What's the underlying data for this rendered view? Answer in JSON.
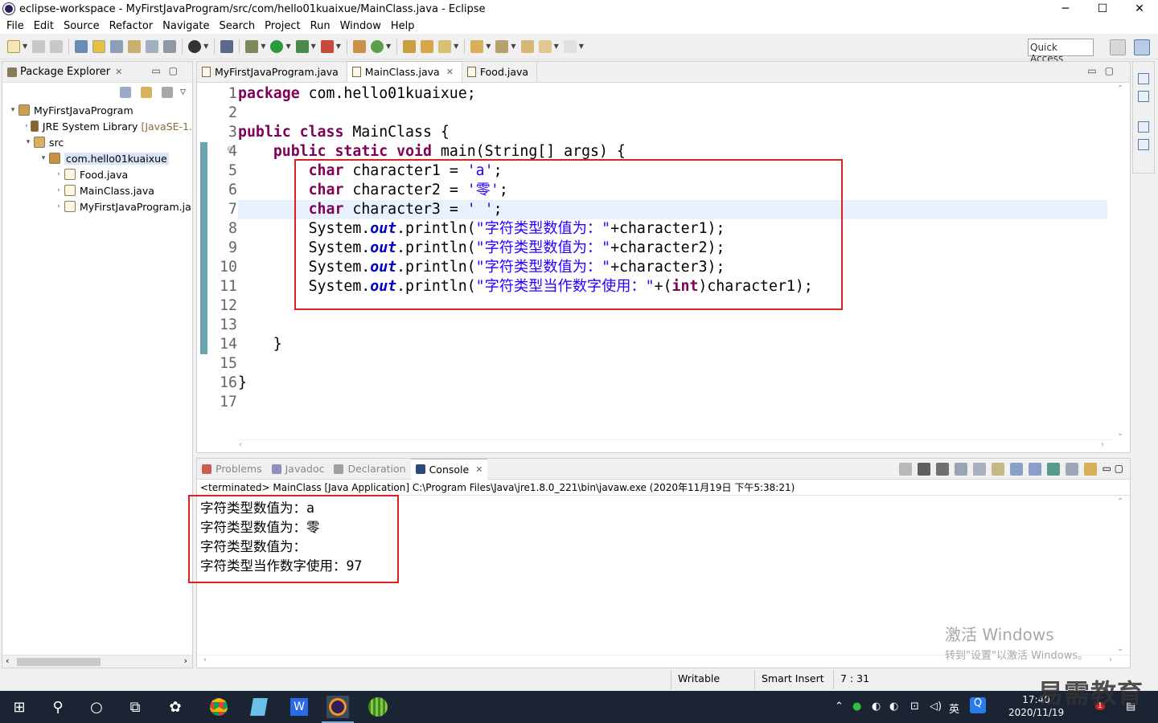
{
  "window": {
    "title": "eclipse-workspace - MyFirstJavaProgram/src/com/hello01kuaixue/MainClass.java - Eclipse",
    "controls": [
      "─",
      "☐",
      "✕"
    ]
  },
  "menu": [
    "File",
    "Edit",
    "Source",
    "Refactor",
    "Navigate",
    "Search",
    "Project",
    "Run",
    "Window",
    "Help"
  ],
  "toolbar": {
    "quick_access": "Quick Access"
  },
  "package_explorer": {
    "title": "Package Explorer",
    "close": "✕",
    "tree": [
      {
        "indent": 0,
        "arrow": "▾",
        "name": "MyFirstJavaProgram",
        "extra": "",
        "icon_color": "#c8a050"
      },
      {
        "indent": 1,
        "arrow": "›",
        "name": "JRE System Library",
        "extra": "[JavaSE-1.",
        "icon_color": "#8a6030"
      },
      {
        "indent": 1,
        "arrow": "▾",
        "name": "src",
        "extra": "",
        "icon_color": "#d8b060"
      },
      {
        "indent": 2,
        "arrow": "▾",
        "name": "com.hello01kuaixue",
        "extra": "",
        "icon_color": "#c89040",
        "selected": true
      },
      {
        "indent": 3,
        "arrow": "›",
        "name": "Food.java",
        "extra": "",
        "icon_color": "#fdf6e0"
      },
      {
        "indent": 3,
        "arrow": "›",
        "name": "MainClass.java",
        "extra": "",
        "icon_color": "#fdf6e0"
      },
      {
        "indent": 3,
        "arrow": "›",
        "name": "MyFirstJavaProgram.ja",
        "extra": "",
        "icon_color": "#fdf6e0"
      }
    ]
  },
  "editor": {
    "tabs": [
      {
        "label": "MyFirstJavaProgram.java",
        "active": false,
        "close": ""
      },
      {
        "label": "MainClass.java",
        "active": true,
        "close": "✕"
      },
      {
        "label": "Food.java",
        "active": false,
        "close": ""
      }
    ],
    "line_numbers": [
      "1",
      "2",
      "3",
      "4",
      "5",
      "6",
      "7",
      "8",
      "9",
      "10",
      "11",
      "12",
      "13",
      "14",
      "15",
      "16",
      "17"
    ],
    "current_line": 7,
    "lines": [
      [
        {
          "t": "kw",
          "v": "package"
        },
        {
          "t": "",
          "v": " com.hello01kuaixue;"
        }
      ],
      [],
      [
        {
          "t": "kw",
          "v": "public"
        },
        {
          "t": "",
          "v": " "
        },
        {
          "t": "kw",
          "v": "class"
        },
        {
          "t": "",
          "v": " MainClass {"
        }
      ],
      [
        {
          "t": "",
          "v": "    "
        },
        {
          "t": "kw",
          "v": "public"
        },
        {
          "t": "",
          "v": " "
        },
        {
          "t": "kw",
          "v": "static"
        },
        {
          "t": "",
          "v": " "
        },
        {
          "t": "kw",
          "v": "void"
        },
        {
          "t": "",
          "v": " main(String[] args) {"
        }
      ],
      [
        {
          "t": "",
          "v": "        "
        },
        {
          "t": "kw",
          "v": "char"
        },
        {
          "t": "",
          "v": " character1 = "
        },
        {
          "t": "str",
          "v": "'a'"
        },
        {
          "t": "",
          "v": ";"
        }
      ],
      [
        {
          "t": "",
          "v": "        "
        },
        {
          "t": "kw",
          "v": "char"
        },
        {
          "t": "",
          "v": " character2 = "
        },
        {
          "t": "str",
          "v": "'零'"
        },
        {
          "t": "",
          "v": ";"
        }
      ],
      [
        {
          "t": "",
          "v": "        "
        },
        {
          "t": "kw",
          "v": "char"
        },
        {
          "t": "",
          "v": " character3 = "
        },
        {
          "t": "str",
          "v": "' '"
        },
        {
          "t": "",
          "v": ";"
        }
      ],
      [
        {
          "t": "",
          "v": "        System."
        },
        {
          "t": "fld",
          "v": "out"
        },
        {
          "t": "",
          "v": ".println("
        },
        {
          "t": "str",
          "v": "\"字符类型数值为：\""
        },
        {
          "t": "",
          "v": "+character1);"
        }
      ],
      [
        {
          "t": "",
          "v": "        System."
        },
        {
          "t": "fld",
          "v": "out"
        },
        {
          "t": "",
          "v": ".println("
        },
        {
          "t": "str",
          "v": "\"字符类型数值为：\""
        },
        {
          "t": "",
          "v": "+character2);"
        }
      ],
      [
        {
          "t": "",
          "v": "        System."
        },
        {
          "t": "fld",
          "v": "out"
        },
        {
          "t": "",
          "v": ".println("
        },
        {
          "t": "str",
          "v": "\"字符类型数值为：\""
        },
        {
          "t": "",
          "v": "+character3);"
        }
      ],
      [
        {
          "t": "",
          "v": "        System."
        },
        {
          "t": "fld",
          "v": "out"
        },
        {
          "t": "",
          "v": ".println("
        },
        {
          "t": "str",
          "v": "\"字符类型当作数字使用：\""
        },
        {
          "t": "",
          "v": "+("
        },
        {
          "t": "kw",
          "v": "int"
        },
        {
          "t": "",
          "v": ")character1);"
        }
      ],
      [],
      [],
      [
        {
          "t": "",
          "v": "    }"
        }
      ],
      [],
      [
        {
          "t": "",
          "v": "}"
        }
      ],
      []
    ]
  },
  "console": {
    "tabs": [
      {
        "label": "Problems",
        "active": false,
        "icon_color": "#c86050"
      },
      {
        "label": "Javadoc",
        "active": false,
        "icon_color": "#9090c0"
      },
      {
        "label": "Declaration",
        "active": false,
        "icon_color": "#a0a0a0"
      },
      {
        "label": "Console",
        "active": true,
        "icon_color": "#2a4a7a"
      }
    ],
    "close": "✕",
    "status": "<terminated> MainClass [Java Application] C:\\Program Files\\Java\\jre1.8.0_221\\bin\\javaw.exe (2020年11月19日 下午5:38:21)",
    "output": [
      "字符类型数值为：a",
      "字符类型数值为：零",
      "字符类型数值为：",
      "字符类型当作数字使用：97"
    ]
  },
  "watermark": {
    "line1": "激活 Windows",
    "line2": "转到\"设置\"以激活 Windows。"
  },
  "statusbar": {
    "writable": "Writable",
    "insert_mode": "Smart Insert",
    "position": "7 : 31"
  },
  "taskbar": {
    "time": "17:40",
    "date": "2020/11/19",
    "ime": "英",
    "notification_badge": "1"
  },
  "brand": "易需教育",
  "colors": {
    "keyword": "#7f0055",
    "string": "#2a00ff",
    "field": "#0000c0",
    "highlight_box": "#e02020",
    "current_line": "#e8f2fe"
  }
}
